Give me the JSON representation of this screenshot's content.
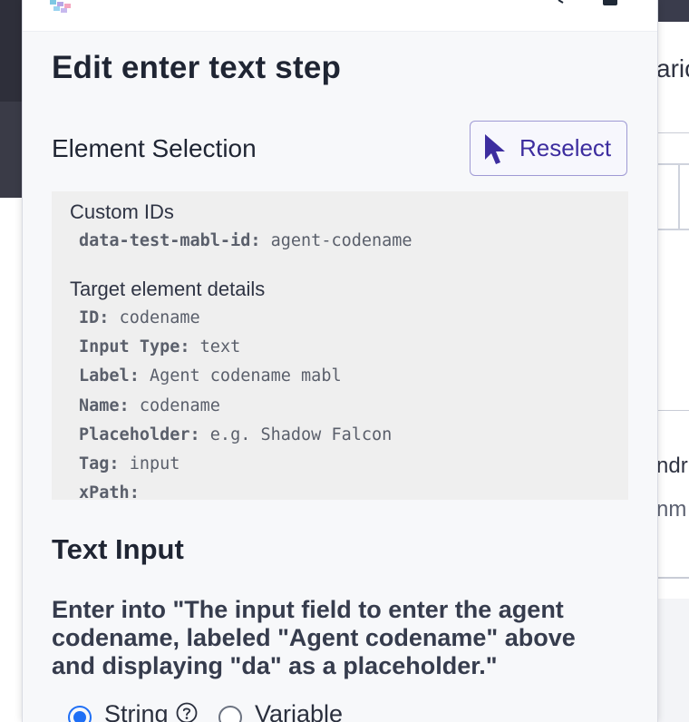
{
  "background": {
    "right_partial_text_1": "aric",
    "right_partial_text_2": "ndr",
    "right_partial_text_3": "nm"
  },
  "modal": {
    "title": "Edit enter text step",
    "element_selection_label": "Element Selection",
    "reselect_button_label": "Reselect",
    "custom_ids": {
      "title": "Custom IDs",
      "items": [
        {
          "key": "data-test-mabl-id:",
          "value": "agent-codename"
        }
      ]
    },
    "target_details": {
      "title": "Target element details",
      "items": [
        {
          "key": "ID:",
          "value": "codename"
        },
        {
          "key": "Input Type:",
          "value": "text"
        },
        {
          "key": "Label:",
          "value": "Agent codename mabl"
        },
        {
          "key": "Name:",
          "value": "codename"
        },
        {
          "key": "Placeholder:",
          "value": "e.g. Shadow Falcon"
        },
        {
          "key": "Tag:",
          "value": "input"
        },
        {
          "key": "xPath:",
          "value": ""
        }
      ]
    },
    "text_input_heading": "Text Input",
    "description": "Enter into \"The input field to enter the agent codename, labeled \"Agent codename\" above and displaying \"da\" as a placeholder.\"",
    "input_type_options": [
      {
        "label": "String",
        "selected": true
      },
      {
        "label": "Variable",
        "selected": false
      }
    ]
  },
  "colors": {
    "accent": "#3d2d9f",
    "radio_selected": "#1f6ff5",
    "details_bg": "#efefef"
  },
  "icons": {
    "reselect": "cursor-pointer-icon",
    "help": "question-circle-icon",
    "logo": "mabl-logo-icon"
  }
}
